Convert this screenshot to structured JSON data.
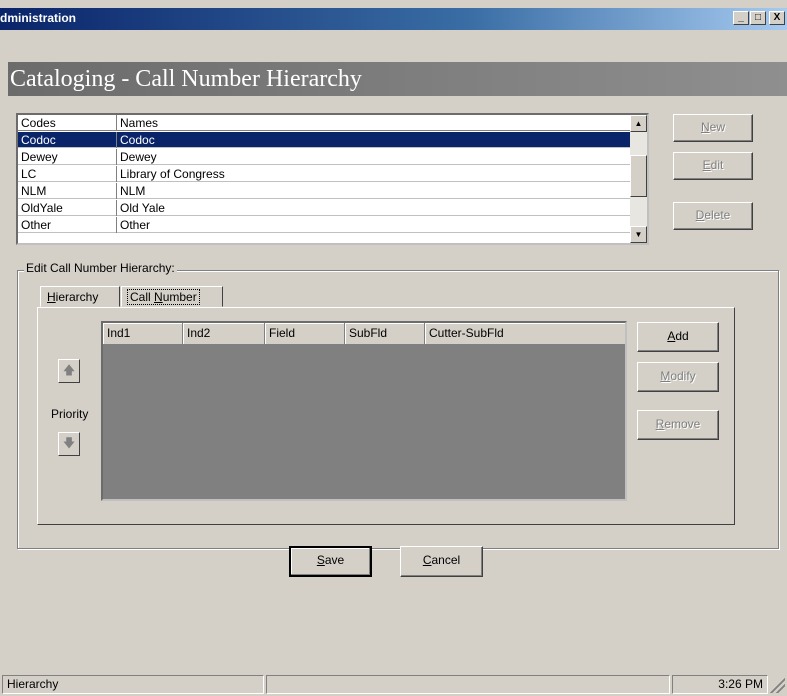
{
  "window": {
    "title": "dministration",
    "minimize_glyph": "_",
    "maximize_glyph": "□",
    "close_glyph": "X"
  },
  "page": {
    "title": "Cataloging - Call Number Hierarchy"
  },
  "list": {
    "columns": [
      "Codes",
      "Names"
    ],
    "rows": [
      {
        "code": "Codoc",
        "name": "Codoc",
        "selected": true
      },
      {
        "code": "Dewey",
        "name": "Dewey"
      },
      {
        "code": "LC",
        "name": "Library of Congress"
      },
      {
        "code": "NLM",
        "name": "NLM"
      },
      {
        "code": "OldYale",
        "name": "Old Yale"
      },
      {
        "code": "Other",
        "name": "Other"
      }
    ],
    "scroll_up_glyph": "▲",
    "scroll_down_glyph": "▼"
  },
  "side_buttons": {
    "new": {
      "mnemonic": "N",
      "rest": "ew"
    },
    "edit": {
      "mnemonic": "E",
      "rest": "dit"
    },
    "delete": {
      "mnemonic": "D",
      "rest": "elete"
    }
  },
  "edit_group": {
    "label": "Edit Call Number Hierarchy:",
    "tabs": [
      {
        "mnemonic": "H",
        "rest": "ierarchy"
      },
      {
        "prefix": "Call ",
        "mnemonic": "N",
        "rest": "umber"
      }
    ]
  },
  "priority": {
    "label": "Priority",
    "up_glyph": "🡅",
    "down_glyph": "🡇"
  },
  "fields_grid": {
    "columns": [
      "Ind1",
      "Ind2",
      "Field",
      "SubFld",
      "Cutter-SubFld"
    ]
  },
  "grid_buttons": {
    "add": {
      "mnemonic": "A",
      "rest": "dd"
    },
    "modify": {
      "mnemonic": "M",
      "rest": "odify"
    },
    "remove": {
      "mnemonic": "R",
      "rest": "emove"
    }
  },
  "footer_buttons": {
    "save": {
      "mnemonic": "S",
      "rest": "ave"
    },
    "cancel": {
      "mnemonic": "C",
      "rest": "ancel"
    }
  },
  "status_bar": {
    "panel1": "Hierarchy",
    "panel2": "",
    "clock": "3:26 PM"
  }
}
